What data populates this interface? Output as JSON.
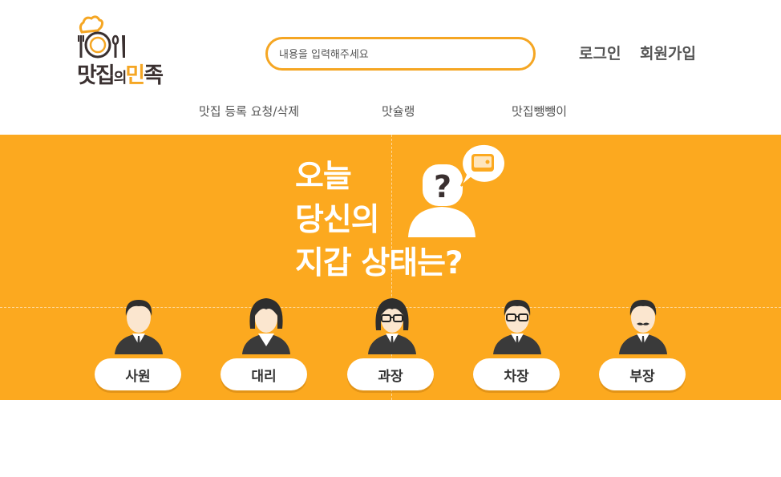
{
  "logo": {
    "part1": "맛집",
    "part2": "의",
    "part3": "민",
    "part4": "족"
  },
  "search": {
    "placeholder": "내용을 입력해주세요"
  },
  "auth": {
    "login": "로그인",
    "signup": "회원가입"
  },
  "nav": [
    {
      "label": "맛집 등록 요청/삭제"
    },
    {
      "label": "맛슐랭"
    },
    {
      "label": "맛집뺑뺑이"
    }
  ],
  "banner": {
    "line1": "오늘",
    "line2": "당신의",
    "line3": "지갑 상태는?",
    "question_mark": "?",
    "accent_color": "#fca91f"
  },
  "ranks": [
    {
      "label": "사원"
    },
    {
      "label": "대리"
    },
    {
      "label": "과장"
    },
    {
      "label": "차장"
    },
    {
      "label": "부장"
    }
  ]
}
